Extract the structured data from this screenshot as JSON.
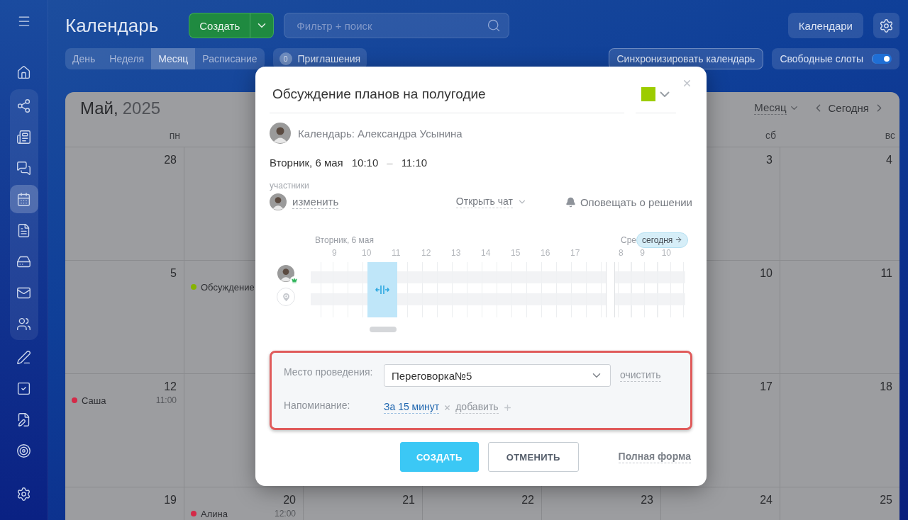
{
  "sidebar": {
    "items": [
      {
        "selected": false
      },
      {
        "selected": false
      },
      {
        "selected": false
      },
      {
        "selected": false
      },
      {
        "selected": true
      },
      {
        "selected": false
      },
      {
        "selected": false
      },
      {
        "selected": false
      },
      {
        "selected": false
      },
      {
        "selected": false
      },
      {
        "selected": false
      },
      {
        "selected": false
      },
      {
        "selected": false
      }
    ]
  },
  "header": {
    "title": "Календарь",
    "create_button": "Создать",
    "search": {
      "placeholder": "Фильтр + поиск"
    },
    "calendars_button": "Календари"
  },
  "view_tabs": [
    {
      "label": "День",
      "selected": false
    },
    {
      "label": "Неделя",
      "selected": false
    },
    {
      "label": "Месяц",
      "selected": true
    },
    {
      "label": "Расписание",
      "selected": false
    }
  ],
  "invitations": {
    "label": "Приглашения",
    "count": "0"
  },
  "sync_button": "Синхронизировать календарь",
  "free_slots": {
    "label": "Свободные слоты",
    "on": true
  },
  "calendar": {
    "month": "Май,",
    "year": "2025",
    "view_select": "Месяц",
    "today_button": "Сегодня",
    "weekdays": {
      "column_1": "пн",
      "column_6": "сб",
      "column_7": "вс"
    },
    "weeks": [
      {
        "column_1": {
          "day": "28"
        },
        "column_6": {
          "day": "3"
        },
        "column_7": {
          "day": "4"
        }
      },
      {
        "column_1": {
          "day": "5"
        },
        "column_2": {
          "events": [
            {
              "name": "Обсуждение",
              "color": "#86b300"
            }
          ]
        },
        "column_6": {
          "day": "10"
        },
        "column_7": {
          "day": "11"
        }
      },
      {
        "column_1": {
          "day": "12",
          "events": [
            {
              "name": "Саша",
              "time": "11:00",
              "color": "#d42a48"
            }
          ]
        },
        "column_6": {
          "day": "17"
        },
        "column_7": {
          "day": "18"
        }
      },
      {
        "column_1": {
          "day": "19"
        },
        "column_2": {
          "day": "20",
          "events": [
            {
              "name": "Алина",
              "time": "12:00",
              "color": "#d42a48"
            }
          ]
        },
        "column_3": {
          "day": "21"
        },
        "column_4": {
          "day": "22"
        },
        "column_5": {
          "day": "23"
        },
        "column_6": {
          "day": "24"
        },
        "column_7": {
          "day": "25"
        }
      }
    ]
  },
  "dialog": {
    "title_value": "Обсуждение планов на полугодие",
    "color": "#9ccc00",
    "calendar_owner": "Календарь: Александра Усынина",
    "date": "Вторник, 6 мая",
    "time_from": "10:10",
    "time_separator": "–",
    "time_to": "11:10",
    "participants_label": "участники",
    "change_link": "изменить",
    "open_chat": "Открыть чат",
    "notify": "Оповещать о решении",
    "planner": {
      "day_label": "Вторник, 6 мая",
      "next_day_label": "Сре",
      "today_badge": "сегодня",
      "hours": [
        "9",
        "10",
        "11",
        "12",
        "13",
        "14",
        "15",
        "16",
        "17"
      ],
      "next_hours": [
        "8",
        "9",
        "10"
      ]
    },
    "location": {
      "label": "Место проведения:",
      "value": "Переговорка№5",
      "clear_link": "очистить"
    },
    "reminder": {
      "label": "Напоминание:",
      "value": "За 15 минут",
      "add_link": "добавить"
    },
    "buttons": {
      "create": "СОЗДАТЬ",
      "cancel": "ОТМЕНИТЬ",
      "full_form": "Полная форма"
    }
  }
}
